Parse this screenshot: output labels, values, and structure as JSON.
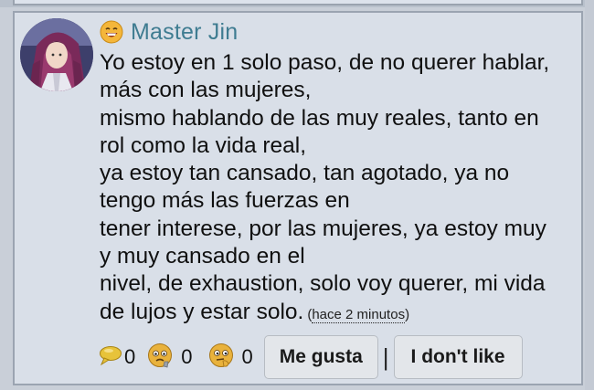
{
  "comment": {
    "author": {
      "name": "Master Jin",
      "avatar_icon": "anime-character-avatar",
      "badge_icon": "grinning-emoji-icon"
    },
    "body_lines": [
      "Yo estoy en 1 solo paso, de no querer hablar,",
      "más con las mujeres,",
      "mismo hablando de las muy reales, tanto en",
      "rol como la vida real,",
      "ya estoy tan cansado, tan agotado, ya no",
      "tengo más las fuerzas en",
      "tener interese, por las mujeres, ya estoy muy",
      "y muy cansado en el",
      "nivel, de exhaustion, solo voy querer, mi vida",
      "de lujos y estar solo."
    ],
    "time": {
      "open": "(",
      "label": "hace 2 minutos",
      "close": ")"
    },
    "reactions": [
      {
        "icon": "speech-bubble-icon",
        "count": "0"
      },
      {
        "icon": "worried-face-icon",
        "count": "0"
      },
      {
        "icon": "thinking-face-icon",
        "count": "0"
      }
    ],
    "actions": {
      "like_label": "Me gusta",
      "separator": "|",
      "dislike_label": "I don't like"
    }
  },
  "colors": {
    "author_name": "#3f7c91",
    "card_background": "#d9dfe8",
    "page_background": "#c9cfd8"
  }
}
